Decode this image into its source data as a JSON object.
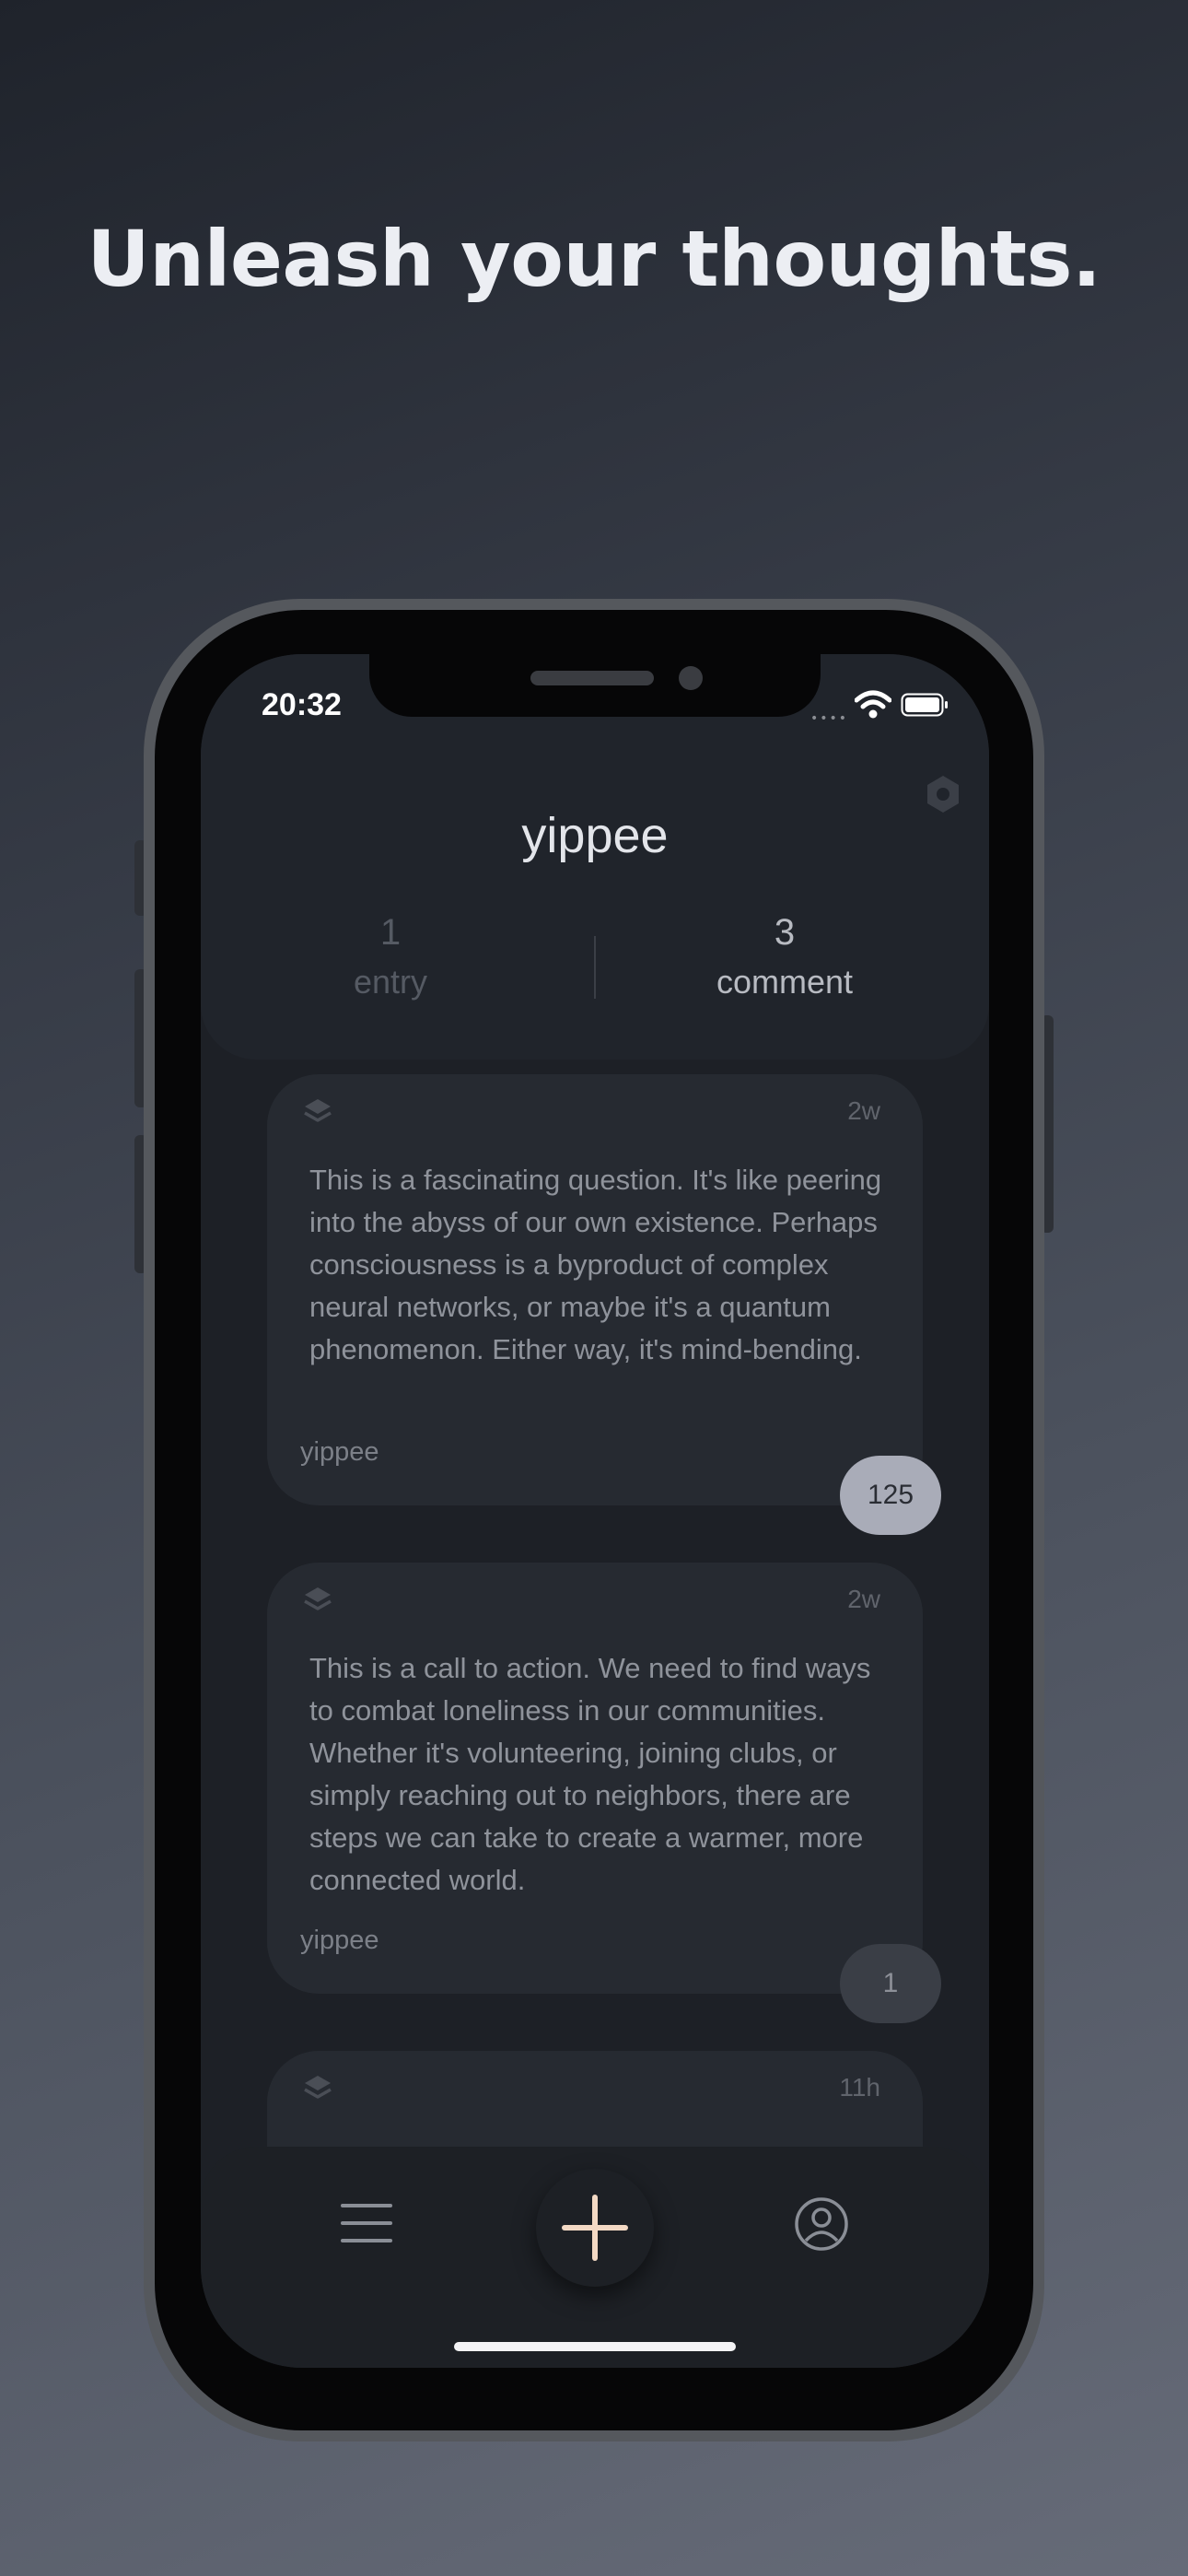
{
  "headline": "Unleash your thoughts.",
  "status_bar": {
    "time": "20:32"
  },
  "profile": {
    "username": "yippee",
    "stats": [
      {
        "value": "1",
        "label": "entry"
      },
      {
        "value": "3",
        "label": "comment"
      }
    ]
  },
  "posts": [
    {
      "time": "2w",
      "text": "This is a fascinating question. It's like peering into the abyss of our own existence. Perhaps consciousness is a byproduct of complex neural networks, or maybe it's a quantum phenomenon. Either way, it's mind-bending.",
      "author": "yippee",
      "count": "125"
    },
    {
      "time": "2w",
      "text": "This is a call to action. We need to find ways to combat loneliness in our communities. Whether it's volunteering, joining clubs, or simply reaching out to neighbors, there are steps we can take to create a warmer, more connected world.",
      "author": "yippee",
      "count": "1"
    },
    {
      "time": "11h"
    }
  ],
  "icons": {
    "settings": "settings-icon",
    "layers": "layers-icon",
    "menu": "menu-icon",
    "add": "plus-icon",
    "profile": "profile-icon"
  },
  "colors": {
    "add_accent": "#f3d9c4",
    "badge_highlight": "#a9acb8"
  }
}
